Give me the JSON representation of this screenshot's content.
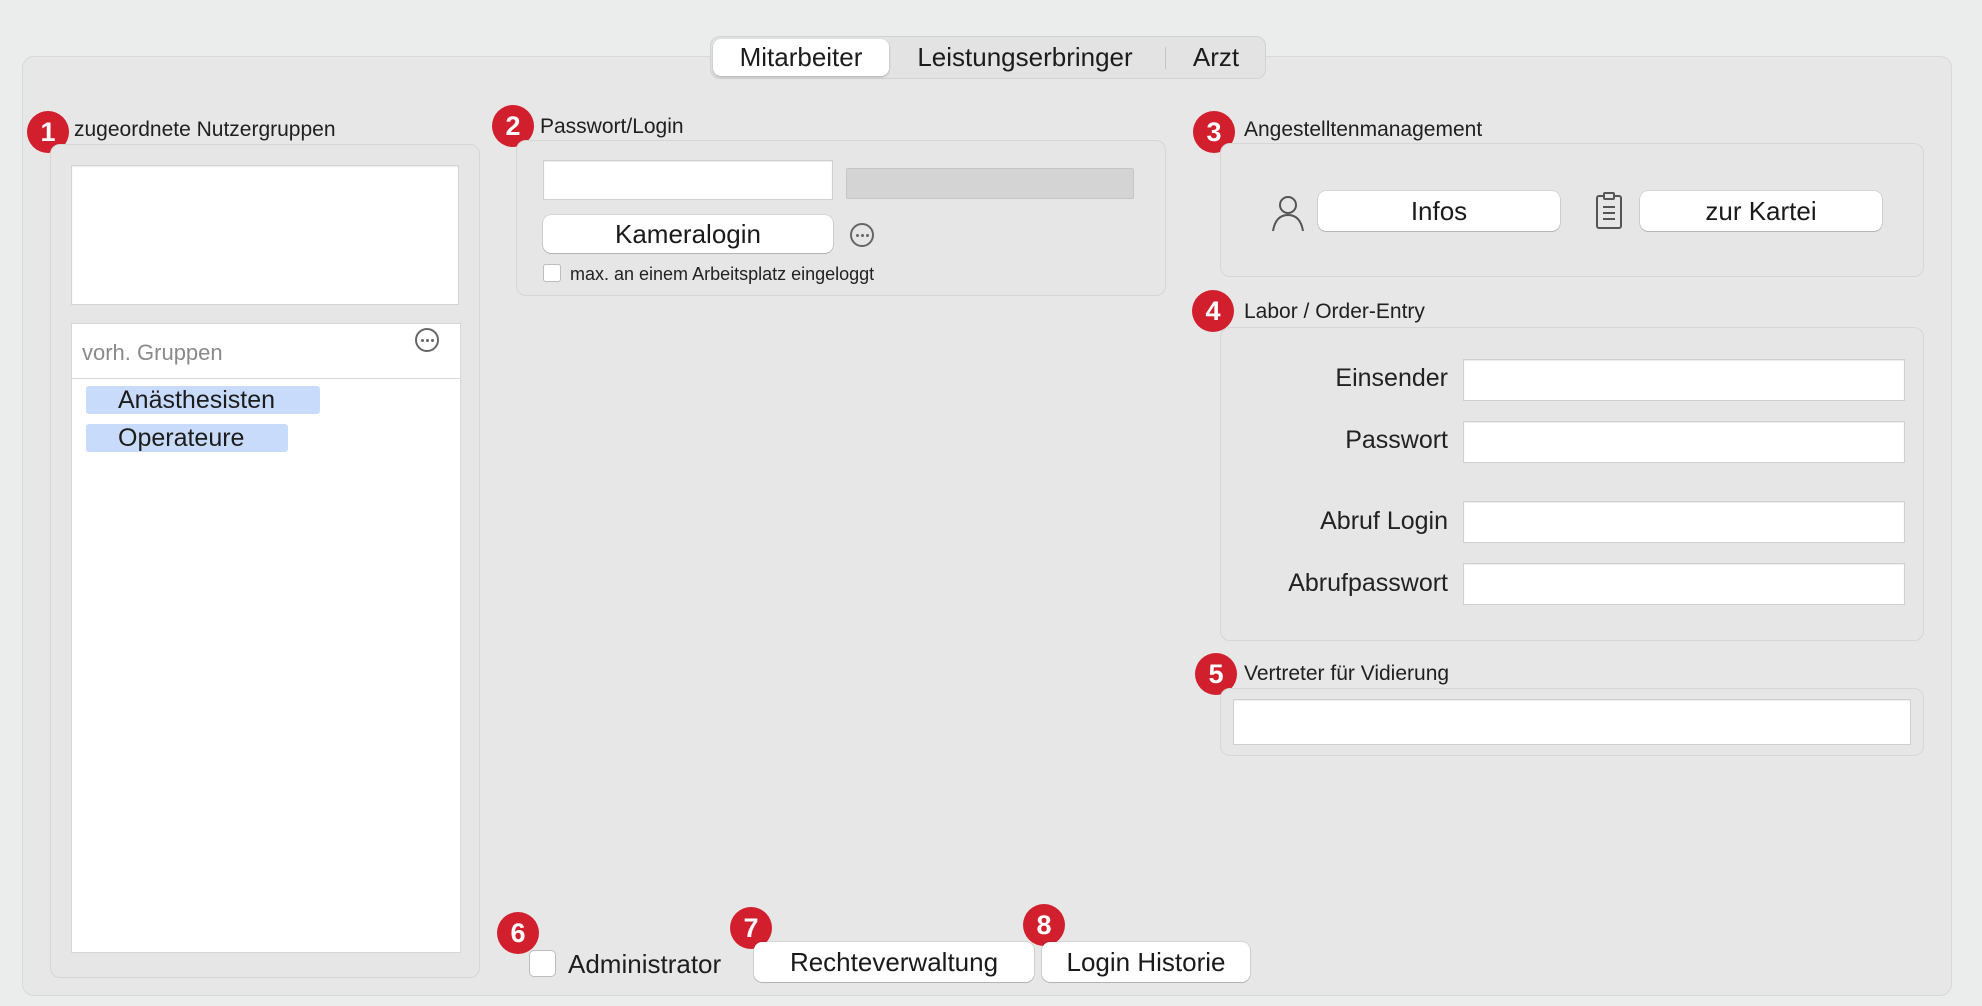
{
  "tabs": {
    "mitarbeiter": "Mitarbeiter",
    "leistungserbringer": "Leistungserbringer",
    "arzt": "Arzt",
    "selected": "Mitarbeiter"
  },
  "badges": [
    "1",
    "2",
    "3",
    "4",
    "5",
    "6",
    "7",
    "8"
  ],
  "groups": {
    "title": "zugeordnete Nutzergruppen",
    "available_placeholder": "vorh. Gruppen",
    "items": [
      "Anästhesisten",
      "Operateure"
    ],
    "more_icon": "ellipsis-circle-icon"
  },
  "login": {
    "title": "Passwort/Login",
    "password_value": "",
    "camera_button": "Kameralogin",
    "single_workstation_label": "max. an einem Arbeitsplatz eingeloggt",
    "single_workstation_checked": false,
    "more_icon": "ellipsis-circle-icon"
  },
  "employee_mgmt": {
    "title": "Angestelltenmanagement",
    "infos_button": "Infos",
    "infos_icon": "person-icon",
    "kartei_button": "zur Kartei",
    "kartei_icon": "clipboard-icon"
  },
  "lab": {
    "title": "Labor / Order-Entry",
    "einsender_label": "Einsender",
    "einsender_value": "",
    "passwort_label": "Passwort",
    "passwort_value": "",
    "abruf_login_label": "Abruf Login",
    "abruf_login_value": "",
    "abrufpasswort_label": "Abrufpasswort",
    "abrufpasswort_value": ""
  },
  "substitute": {
    "title": "Vertreter für Vidierung",
    "value": ""
  },
  "footer": {
    "admin_label": "Administrator",
    "admin_checked": false,
    "rights_button": "Rechteverwaltung",
    "history_button": "Login Historie"
  },
  "colors": {
    "badge": "#d21f2d",
    "chip": "#c8dbfb",
    "background": "#ebecec"
  }
}
